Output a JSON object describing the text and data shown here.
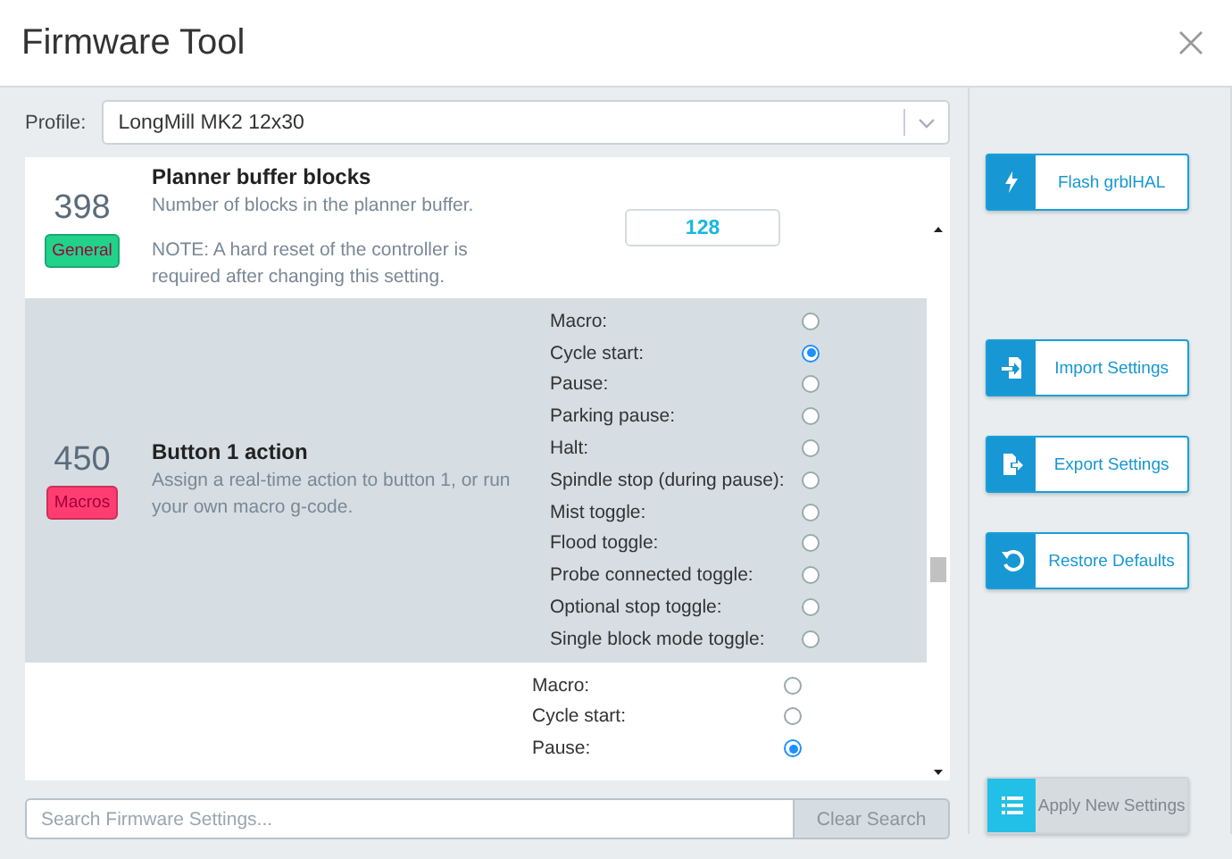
{
  "window": {
    "title": "Firmware Tool"
  },
  "profile": {
    "label": "Profile:",
    "value": "LongMill MK2 12x30"
  },
  "settings": [
    {
      "kind": "number",
      "number": "398",
      "category": "General",
      "color": "#21d28a",
      "title": "Planner buffer blocks",
      "description": "Number of blocks in the planner buffer.",
      "note": "NOTE: A hard reset of the controller is required after changing this setting.",
      "value": "128",
      "highlighted": false
    },
    {
      "kind": "radio",
      "number": "450",
      "category": "Macros",
      "color": "#ff3d71",
      "title": "Button 1 action",
      "description": "Assign a real-time action to button 1, or run your own macro g-code.",
      "highlighted": true,
      "options": [
        {
          "label": "Macro:",
          "selected": false
        },
        {
          "label": "Cycle start:",
          "selected": true
        },
        {
          "label": "Pause:",
          "selected": false
        },
        {
          "label": "Parking pause:",
          "selected": false
        },
        {
          "label": "Halt:",
          "selected": false
        },
        {
          "label": "Spindle stop (during pause):",
          "selected": false
        },
        {
          "label": "Mist toggle:",
          "selected": false
        },
        {
          "label": "Flood toggle:",
          "selected": false
        },
        {
          "label": "Probe connected toggle:",
          "selected": false
        },
        {
          "label": "Optional stop toggle:",
          "selected": false
        },
        {
          "label": "Single block mode toggle:",
          "selected": false
        }
      ]
    },
    {
      "kind": "radio",
      "highlighted": false,
      "options": [
        {
          "label": "Macro:",
          "selected": false
        },
        {
          "label": "Cycle start:",
          "selected": false
        },
        {
          "label": "Pause:",
          "selected": true
        }
      ]
    }
  ],
  "search": {
    "placeholder": "Search Firmware Settings...",
    "button": "Clear Search"
  },
  "actions": [
    {
      "label": "Flash grblHAL",
      "disabled": false
    },
    {
      "label": "Import Settings",
      "disabled": false
    },
    {
      "label": "Export Settings",
      "disabled": false
    },
    {
      "label": "Restore Defaults",
      "disabled": false
    },
    {
      "label": "Apply New Settings",
      "disabled": true
    }
  ]
}
